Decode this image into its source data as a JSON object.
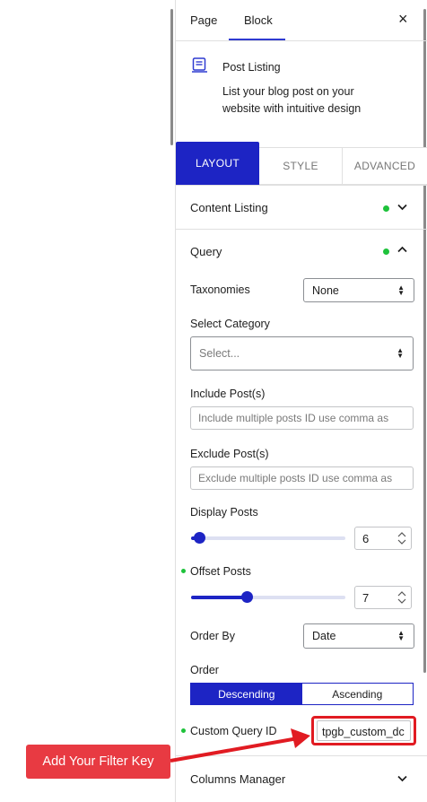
{
  "tabs": {
    "page": "Page",
    "block": "Block",
    "close_icon": "×"
  },
  "block": {
    "icon": "post-listing-icon",
    "title": "Post Listing",
    "description": "List your blog post on your website with intuitive design"
  },
  "panel_tabs": {
    "layout": "LAYOUT",
    "style": "STYLE",
    "advanced": "ADVANCED"
  },
  "sections": {
    "content_listing": "Content Listing",
    "query": "Query",
    "columns_manager": "Columns Manager"
  },
  "query": {
    "taxonomies_label": "Taxonomies",
    "taxonomies_value": "None",
    "select_category_label": "Select Category",
    "select_category_value": "Select...",
    "include_label": "Include Post(s)",
    "include_placeholder": "Include multiple posts ID use comma as",
    "exclude_label": "Exclude Post(s)",
    "exclude_placeholder": "Exclude multiple posts ID use comma as",
    "display_posts_label": "Display Posts",
    "display_posts_value": "6",
    "display_posts_fill": 0.05,
    "offset_posts_label": "Offset Posts",
    "offset_posts_value": "7",
    "offset_posts_fill": 0.36,
    "order_by_label": "Order By",
    "order_by_value": "Date",
    "order_label": "Order",
    "order_desc": "Descending",
    "order_asc": "Ascending",
    "custom_query_label": "Custom Query ID",
    "custom_query_value": "tpgb_custom_dc"
  },
  "annotation": {
    "callout": "Add Your Filter Key"
  },
  "colors": {
    "accent": "#1d24c4",
    "active_dot": "#1ec23b",
    "callout": "#e83a42",
    "highlight": "#e11b22"
  }
}
